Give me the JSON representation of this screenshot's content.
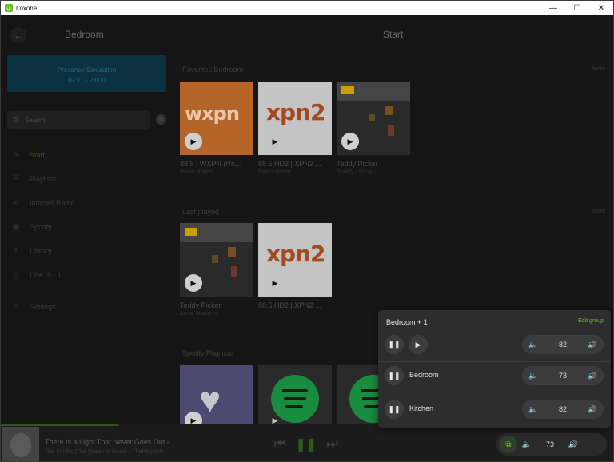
{
  "window": {
    "title": "Loxone",
    "logo_text": "LOXONE"
  },
  "sidebar": {
    "title": "Bedroom",
    "presence": {
      "label": "Presence Simulation",
      "time": "07:11 - 23:00"
    },
    "search_placeholder": "Search",
    "items": [
      {
        "label": "Start",
        "icon": "home-icon"
      },
      {
        "label": "Playlists",
        "icon": "playlist-icon"
      },
      {
        "label": "Internet Radio",
        "icon": "radio-icon"
      },
      {
        "label": "Spotify",
        "icon": "spotify-icon"
      },
      {
        "label": "Library",
        "icon": "library-icon"
      },
      {
        "label": "Line In - 1",
        "icon": "line-in-icon"
      },
      {
        "label": "Settings",
        "icon": "gear-icon"
      }
    ]
  },
  "main": {
    "title": "Start",
    "favorites": {
      "title": "Favorites Bedroom",
      "more": "More",
      "items": [
        {
          "title": "88.5 | WXPN (Ro...",
          "subtitle": "Radio station",
          "art_text": "wxpn"
        },
        {
          "title": "88.5 HD2 | XPN2 ...",
          "subtitle": "Radio station",
          "art_text": "xpn2"
        },
        {
          "title": "Teddy Picker",
          "subtitle": "Spotify - Song"
        }
      ]
    },
    "last_played": {
      "title": "Last played",
      "more": "More",
      "items": [
        {
          "title": "Teddy Picker",
          "subtitle": "Arctic Monkeys"
        },
        {
          "title": "88.5 HD2 | XPN2 ...",
          "subtitle": "",
          "art_text": "xpn2"
        }
      ]
    },
    "spotify_playlists": {
      "title": "Spotify Playlists"
    }
  },
  "player": {
    "track": "There Is a Light That Never Goes Out -",
    "artist": "The Smiths (The Queen Is Dead) • TheHolyShh",
    "volume": "73",
    "progress": 0.19
  },
  "group_popup": {
    "title": "Bedroom + 1",
    "edit_label": "Edit group",
    "master_volume": "82",
    "zones": [
      {
        "name": "Bedroom",
        "volume": "73"
      },
      {
        "name": "Kitchen",
        "volume": "82"
      }
    ]
  },
  "colors": {
    "accent": "#6abf2e",
    "background": "#141414",
    "popup": "#2d2d2d"
  }
}
